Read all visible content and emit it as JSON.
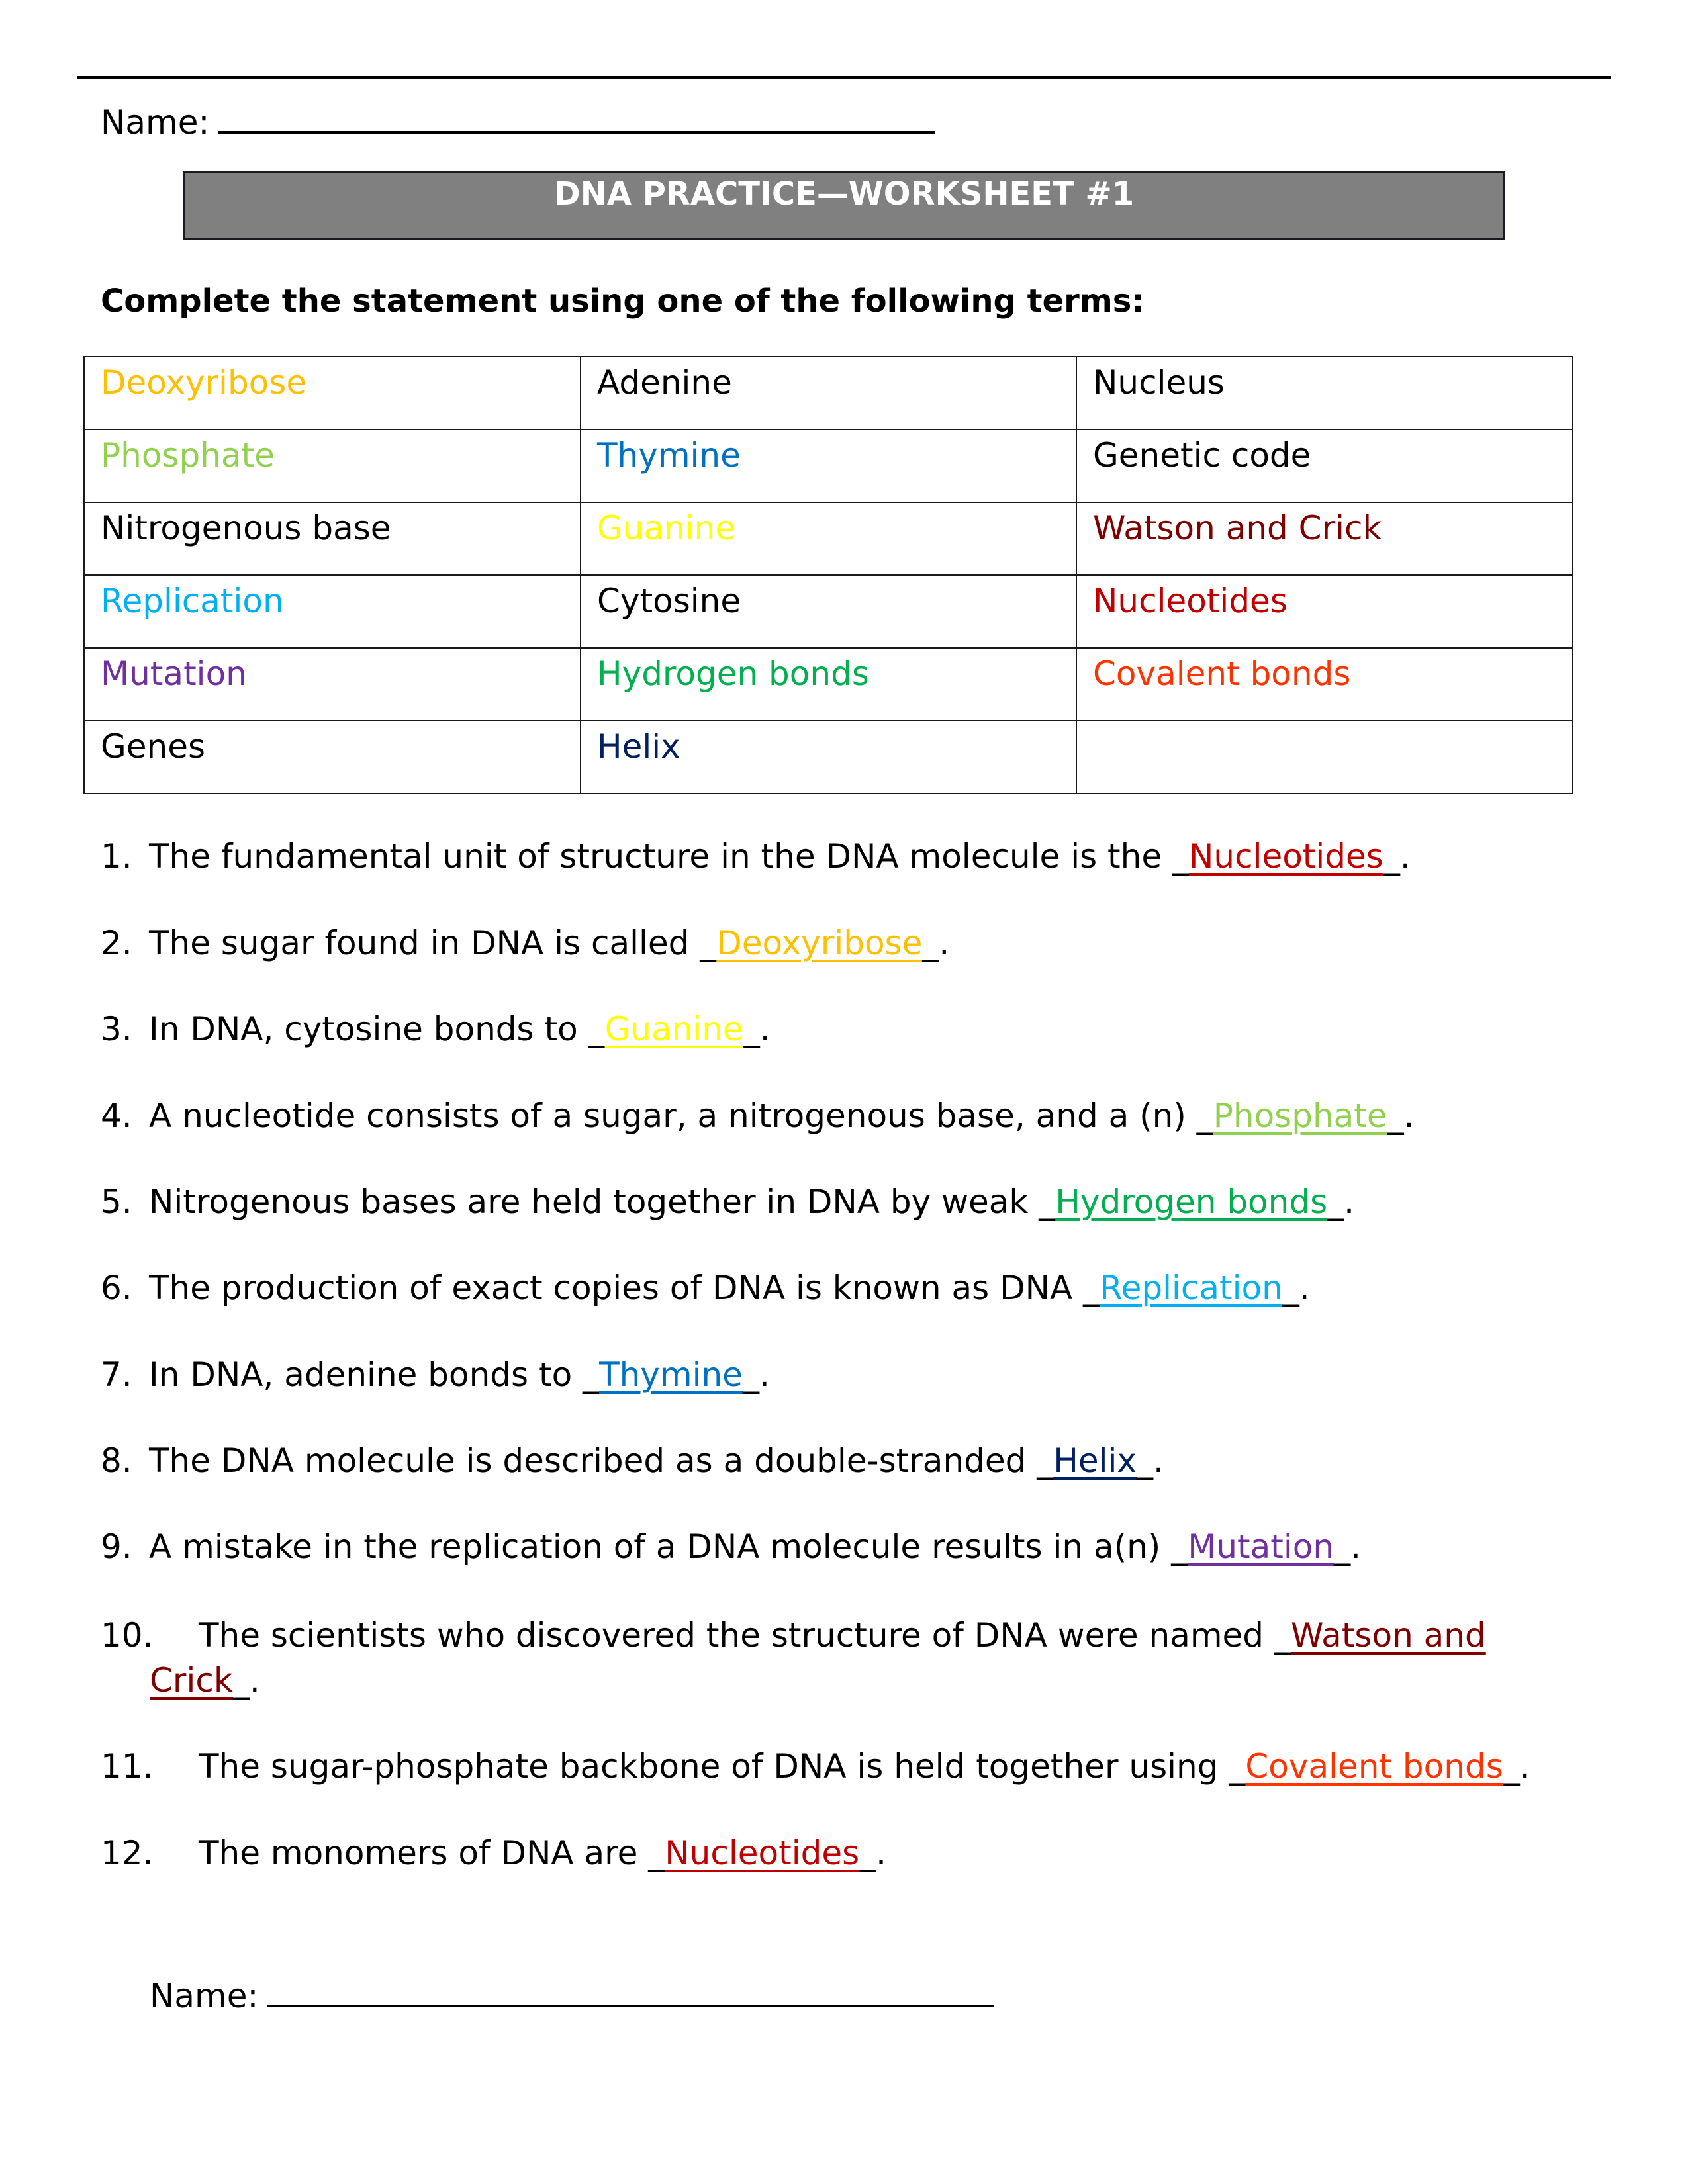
{
  "header": {
    "name_label": "Name:",
    "title": "DNA PRACTICE—WORKSHEET #1",
    "instruction": "Complete the statement using one of the following terms:"
  },
  "terms_table": {
    "rows": [
      [
        {
          "text": "Deoxyribose",
          "color": "#FFC000"
        },
        {
          "text": "Adenine",
          "color": "#000000"
        },
        {
          "text": "Nucleus",
          "color": "#000000"
        }
      ],
      [
        {
          "text": "Phosphate",
          "color": "#92D050"
        },
        {
          "text": "Thymine",
          "color": "#0070C0"
        },
        {
          "text": "Genetic code",
          "color": "#000000"
        }
      ],
      [
        {
          "text": "Nitrogenous base",
          "color": "#000000"
        },
        {
          "text": "Guanine",
          "color": "#FFFF00"
        },
        {
          "text": "Watson and Crick",
          "color": "#800000"
        }
      ],
      [
        {
          "text": "Replication",
          "color": "#00B0F0"
        },
        {
          "text": "Cytosine",
          "color": "#000000"
        },
        {
          "text": "Nucleotides",
          "color": "#C00000"
        }
      ],
      [
        {
          "text": "Mutation",
          "color": "#7030A0"
        },
        {
          "text": "Hydrogen bonds",
          "color": "#00B050"
        },
        {
          "text": "Covalent bonds",
          "color": "#FF3300"
        }
      ],
      [
        {
          "text": "Genes",
          "color": "#000000"
        },
        {
          "text": "Helix",
          "color": "#002060"
        },
        {
          "text": "",
          "color": "#000000"
        }
      ]
    ]
  },
  "questions": [
    {
      "num": "1.",
      "text": "The fundamental unit of structure in the DNA molecule is the ",
      "answer": "Nucleotides",
      "color": "#C00000"
    },
    {
      "num": "2.",
      "text": "The sugar found in DNA is called ",
      "answer": "Deoxyribose",
      "color": "#FFC000"
    },
    {
      "num": "3.",
      "text": "In DNA, cytosine bonds to ",
      "answer": "Guanine",
      "color": "#FFFF00"
    },
    {
      "num": "4.",
      "text": "A nucleotide consists of a sugar, a nitrogenous base, and a (n) ",
      "answer": "Phosphate",
      "color": "#92D050"
    },
    {
      "num": "5.",
      "text": "Nitrogenous bases are held together in DNA by weak ",
      "answer": "Hydrogen bonds",
      "color": "#00B050"
    },
    {
      "num": "6.",
      "text": "The production of exact copies of DNA is known as DNA ",
      "answer": "Replication",
      "color": "#00B0F0"
    },
    {
      "num": "7.",
      "text": "In DNA, adenine bonds to ",
      "answer": "Thymine",
      "color": "#0070C0"
    },
    {
      "num": "8.",
      "text": "The DNA molecule is described as a double-stranded ",
      "answer": "Helix",
      "color": "#002060"
    },
    {
      "num": "9.",
      "text": "A mistake in the replication of a DNA molecule results in a(n) ",
      "answer": "Mutation",
      "color": "#7030A0"
    },
    {
      "num": "10.",
      "text": "The scientists who discovered the structure of DNA were named ",
      "answer": "Watson and ",
      "answer_cont": "Crick",
      "color": "#800000"
    },
    {
      "num": "11.",
      "text": "The sugar-phosphate backbone of DNA is held together using ",
      "answer": "Covalent bonds",
      "color": "#FF3300"
    },
    {
      "num": "12.",
      "text": "The monomers of DNA are ",
      "answer": "Nucleotides",
      "color": "#C00000"
    }
  ],
  "blank_mark": "_",
  "end_mark": ".",
  "footer": {
    "name_label": "Name:"
  }
}
